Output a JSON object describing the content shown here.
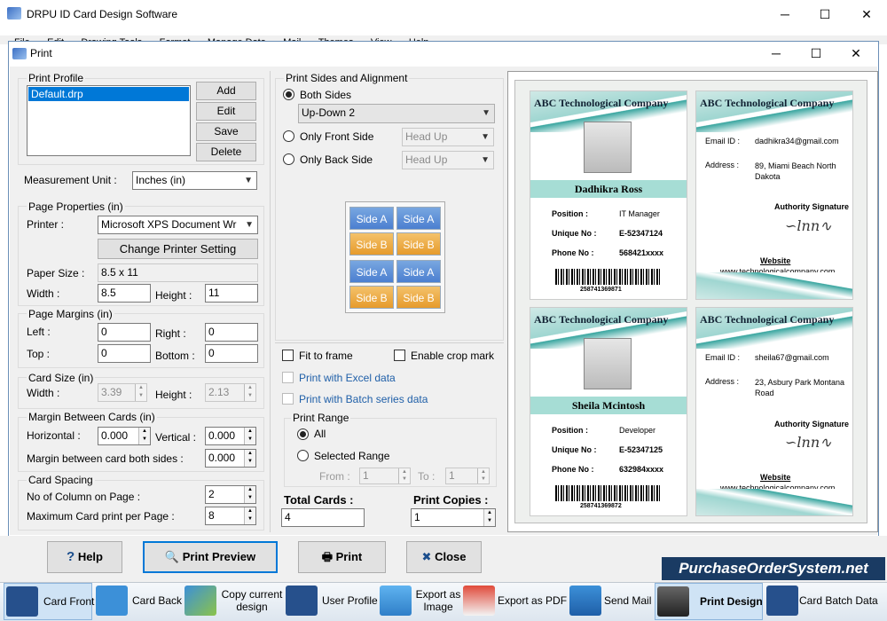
{
  "app": {
    "title": "DRPU ID Card Design Software",
    "menu": [
      "File",
      "Edit",
      "Drawing Tools",
      "Format",
      "Manage Data",
      "Mail",
      "Themes",
      "View",
      "Help"
    ]
  },
  "dialog": {
    "title": "Print"
  },
  "print_profile": {
    "label": "Print Profile",
    "selected": "Default.drp",
    "add": "Add",
    "edit": "Edit",
    "save": "Save",
    "delete": "Delete"
  },
  "measurement": {
    "label": "Measurement Unit :",
    "value": "Inches (in)"
  },
  "page_props": {
    "label": "Page Properties (in)",
    "printer_label": "Printer :",
    "printer_value": "Microsoft XPS Document Wr",
    "change_btn": "Change Printer Setting",
    "paper_label": "Paper Size :",
    "paper_value": "8.5 x 11",
    "width_label": "Width :",
    "width_value": "8.5",
    "height_label": "Height :",
    "height_value": "11"
  },
  "margins": {
    "label": "Page Margins (in)",
    "left_label": "Left :",
    "left_value": "0",
    "right_label": "Right :",
    "right_value": "0",
    "top_label": "Top :",
    "top_value": "0",
    "bottom_label": "Bottom :",
    "bottom_value": "0"
  },
  "card_size": {
    "label": "Card Size (in)",
    "width_label": "Width :",
    "width_value": "3.39",
    "height_label": "Height :",
    "height_value": "2.13"
  },
  "card_margin": {
    "label": "Margin Between Cards (in)",
    "h_label": "Horizontal :",
    "h_value": "0.000",
    "v_label": "Vertical :",
    "v_value": "0.000",
    "both_label": "Margin between card both sides :",
    "both_value": "0.000"
  },
  "spacing": {
    "label": "Card Spacing",
    "cols_label": "No of Column on Page :",
    "cols_value": "2",
    "max_label": "Maximum Card print per Page :",
    "max_value": "8"
  },
  "sides": {
    "label": "Print Sides and Alignment",
    "both": "Both Sides",
    "both_value": "Up-Down 2",
    "front": "Only Front Side",
    "front_value": "Head Up",
    "back": "Only Back Side",
    "back_value": "Head Up",
    "side_a": "Side A",
    "side_b": "Side B"
  },
  "options": {
    "fit": "Fit to frame",
    "crop": "Enable crop mark",
    "excel": "Print with Excel data",
    "batch": "Print with Batch series data"
  },
  "range": {
    "label": "Print Range",
    "all": "All",
    "selected": "Selected Range",
    "from_label": "From :",
    "from_value": "1",
    "to_label": "To :",
    "to_value": "1"
  },
  "totals": {
    "total_label": "Total Cards :",
    "total_value": "4",
    "copies_label": "Print Copies :",
    "copies_value": "1"
  },
  "buttons": {
    "help": "Help",
    "preview": "Print Preview",
    "print": "Print",
    "close": "Close"
  },
  "cards": [
    {
      "company": "ABC Technological Company",
      "name": "Dadhikra Ross",
      "pos_label": "Position :",
      "pos": "IT Manager",
      "uid_label": "Unique No :",
      "uid": "E-52347124",
      "phone_label": "Phone No :",
      "phone": "568421xxxx",
      "barcode": "258741369871",
      "email_label": "Email ID :",
      "email": "dadhikra34@gmail.com",
      "addr_label": "Address :",
      "addr": "89, Miami Beach North Dakota",
      "auth": "Authority Signature",
      "web_label": "Website",
      "web": "www.technologicalcompany.com"
    },
    {
      "company": "ABC Technological Company",
      "name": "Sheila Mcintosh",
      "pos_label": "Position :",
      "pos": "Developer",
      "uid_label": "Unique No :",
      "uid": "E-52347125",
      "phone_label": "Phone No :",
      "phone": "632984xxxx",
      "barcode": "258741369872",
      "email_label": "Email ID :",
      "email": "sheila67@gmail.com",
      "addr_label": "Address :",
      "addr": "23, Asbury Park Montana Road",
      "auth": "Authority Signature",
      "web_label": "Website",
      "web": "www.technologicalcompany.com"
    }
  ],
  "taskbar": [
    "Card Front",
    "Card Back",
    "Copy current design",
    "User Profile",
    "Export as Image",
    "Export as PDF",
    "Send Mail",
    "Print Design",
    "Card Batch Data"
  ],
  "watermark": "PurchaseOrderSystem.net",
  "colors": {
    "accent": "#3aa6a0",
    "selection": "#0078d7",
    "watermark_bg": "#1a3b63"
  }
}
